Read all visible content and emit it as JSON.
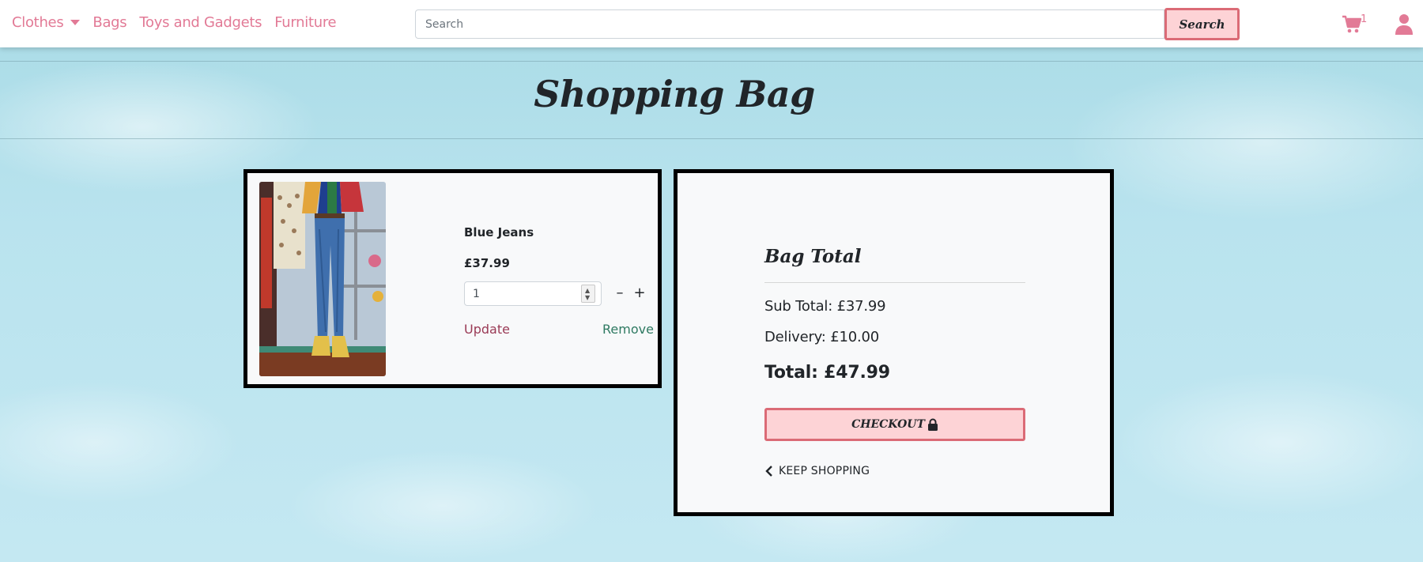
{
  "nav": {
    "links": [
      "Clothes",
      "Bags",
      "Toys and Gadgets",
      "Furniture"
    ],
    "search_placeholder": "Search",
    "search_button": "Search",
    "cart_count": "1",
    "accent_color": "#e27a96"
  },
  "page": {
    "title": "Shopping Bag"
  },
  "bag_item": {
    "name": "Blue Jeans",
    "price": "£37.99",
    "quantity": "1",
    "update_label": "Update",
    "remove_label": "Remove",
    "image_icon": "product-photo"
  },
  "summary": {
    "title": "Bag Total",
    "subtotal": "Sub Total: £37.99",
    "delivery": "Delivery: £10.00",
    "total": "Total: £47.99",
    "checkout_label": "CHECKOUT",
    "keep_shopping_label": "KEEP SHOPPING"
  },
  "colors": {
    "button_fill": "#fdd3d6",
    "button_border": "#db6b76",
    "update_color": "#9a3a55",
    "remove_color": "#2f7a62"
  }
}
